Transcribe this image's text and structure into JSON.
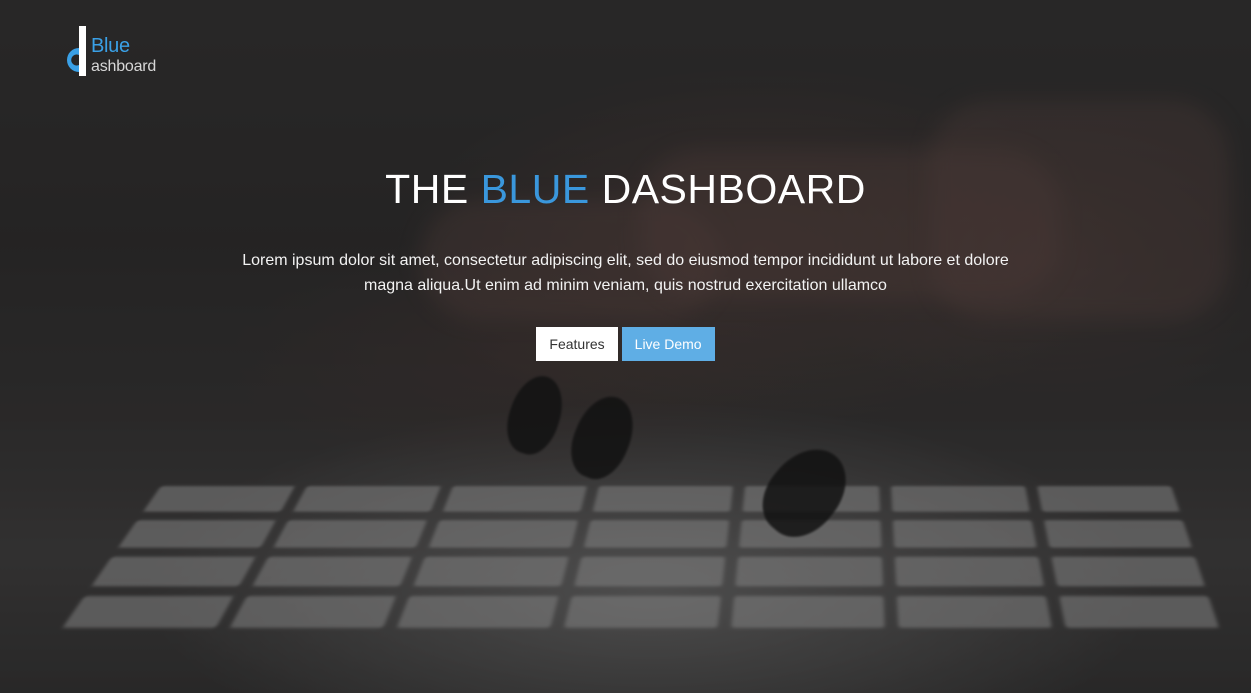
{
  "logo": {
    "line1": "Blue",
    "line2": "ashboard",
    "accent_color": "#3aa0e6"
  },
  "hero": {
    "title_part1": "THE",
    "title_highlight": "BLUE",
    "title_part2": "DASHBOARD",
    "highlight_color": "#3a97dc",
    "description_line1": "Lorem ipsum dolor sit amet, consectetur adipiscing elit, sed do eiusmod tempor incididunt ut labore et dolore",
    "description_line2": "magna aliqua.Ut enim ad minim veniam, quis nostrud exercitation ullamco"
  },
  "actions": {
    "features_label": "Features",
    "demo_label": "Live Demo",
    "demo_color": "#5faee5"
  }
}
